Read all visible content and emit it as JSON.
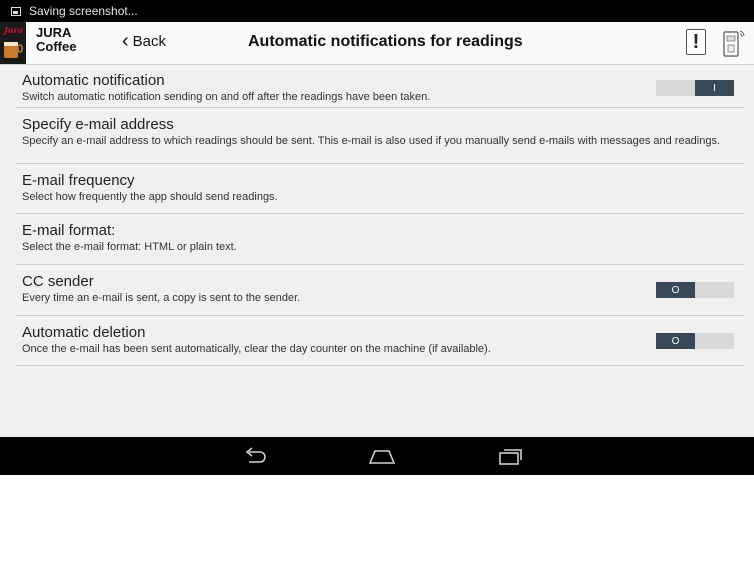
{
  "status_bar": {
    "notification_text": "Saving screenshot..."
  },
  "header": {
    "brand_line1": "JURA",
    "brand_line2": "Coffee",
    "back_label": "Back",
    "title": "Automatic notifications for readings"
  },
  "settings": [
    {
      "title": "Automatic notification",
      "description": "Switch automatic notification sending on and off after the readings have been taken.",
      "toggle": {
        "state": "on",
        "label": "I"
      }
    },
    {
      "title": "Specify e-mail address",
      "description": "Specify an e-mail address to which readings should be sent. This e-mail is also used if you manually send e-mails with messages and readings."
    },
    {
      "title": "E-mail frequency",
      "description": "Select how frequently the app should send readings."
    },
    {
      "title": "E-mail format:",
      "description": "Select the e-mail format: HTML or plain text."
    },
    {
      "title": "CC sender",
      "description": "Every time an e-mail is sent, a copy is sent to the sender.",
      "toggle": {
        "state": "off",
        "label": "O"
      }
    },
    {
      "title": "Automatic deletion",
      "description": "Once the e-mail has been sent automatically, clear the day counter on the machine (if available).",
      "toggle": {
        "state": "off",
        "label": "O"
      }
    }
  ],
  "icons": {
    "status": "screenshot-icon",
    "alert": "exclamation-icon",
    "machine": "coffee-machine-icon",
    "nav_back": "back-arrow-icon",
    "nav_home": "home-icon",
    "nav_recents": "recents-icon"
  },
  "colors": {
    "toggle_dark": "#3a4756",
    "toggle_light": "#d9d9d9",
    "background": "#f0f0f0",
    "brand_red": "#c8102e"
  }
}
